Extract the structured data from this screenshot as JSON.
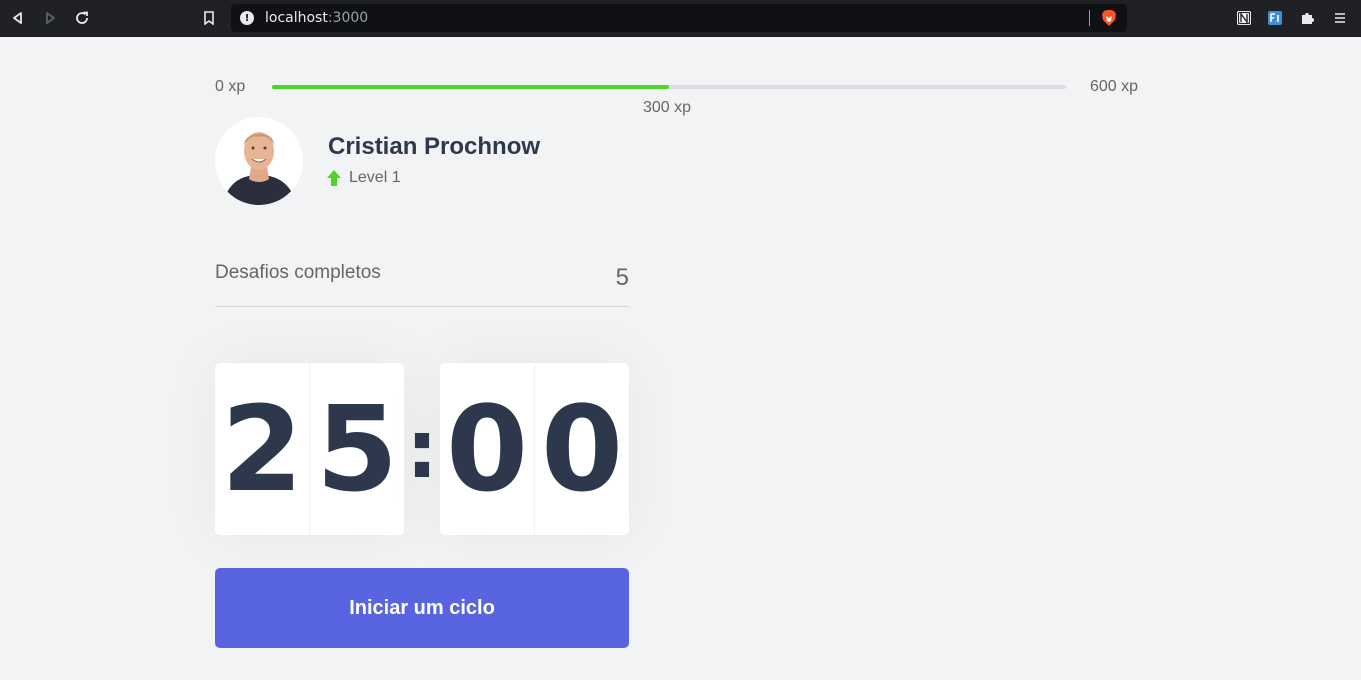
{
  "browser": {
    "address_host": "localhost",
    "address_port": ":3000"
  },
  "xp": {
    "min_label": "0 xp",
    "max_label": "600 xp",
    "current_label": "300 xp",
    "progress_fraction": 0.5,
    "fill_color": "#4cd62b"
  },
  "profile": {
    "name": "Cristian Prochnow",
    "level": "Level 1",
    "level_icon": "level-up-arrow-icon"
  },
  "challenges": {
    "label": "Desafios completos",
    "count": "5"
  },
  "countdown": {
    "minutes_tens": "2",
    "minutes_ones": "5",
    "separator": ":",
    "seconds_tens": "0",
    "seconds_ones": "0"
  },
  "actions": {
    "start_label": "Iniciar um ciclo",
    "start_color": "#5965e0"
  }
}
